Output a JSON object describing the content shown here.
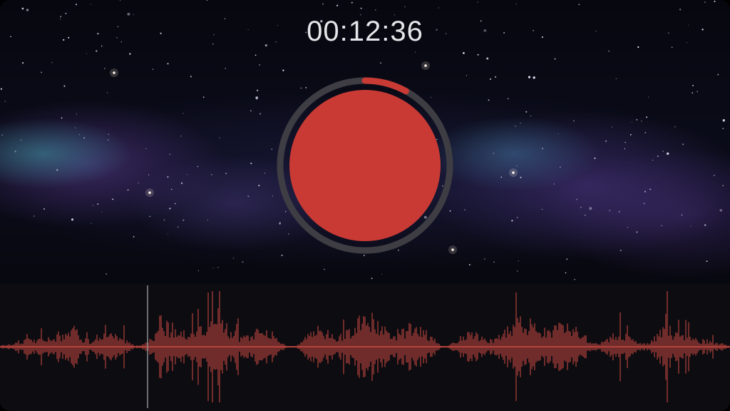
{
  "timer": {
    "elapsed": "00:12:36"
  },
  "recorder": {
    "state": "recording",
    "progress": 0.08,
    "button_icon": "record-icon"
  },
  "colors": {
    "accent": "#c93a34",
    "ring_track": "#3e3d43",
    "waveform": "#b5423c",
    "timer_text": "#e6e6ea",
    "panel_background": "#0d0c11"
  }
}
